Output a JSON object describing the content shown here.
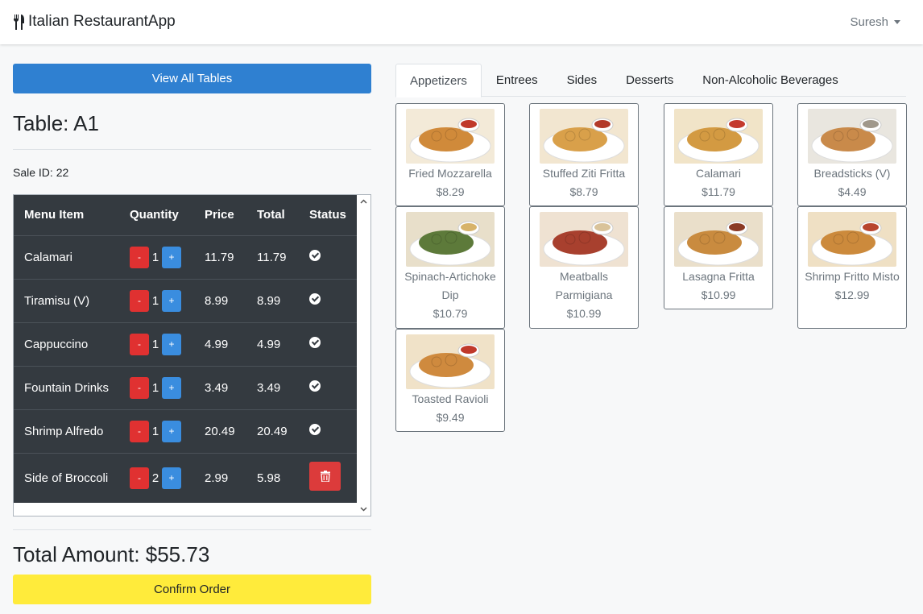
{
  "navbar": {
    "brand": "Italian RestaurantApp",
    "brand_icon": "utensils-icon",
    "user": "Suresh"
  },
  "left": {
    "view_all_tables": "View All Tables",
    "table_title": "Table: A1",
    "sale_id": "Sale ID: 22",
    "headers": [
      "Menu Item",
      "Quantity",
      "Price",
      "Total",
      "Status"
    ],
    "minus_label": "-",
    "plus_label": "+",
    "rows": [
      {
        "item": "Calamari",
        "qty": "1",
        "price": "11.79",
        "total": "11.79",
        "status": "check"
      },
      {
        "item": "Tiramisu (V)",
        "qty": "1",
        "price": "8.99",
        "total": "8.99",
        "status": "check"
      },
      {
        "item": "Cappuccino",
        "qty": "1",
        "price": "4.99",
        "total": "4.99",
        "status": "check"
      },
      {
        "item": "Fountain Drinks",
        "qty": "1",
        "price": "3.49",
        "total": "3.49",
        "status": "check"
      },
      {
        "item": "Shrimp Alfredo",
        "qty": "1",
        "price": "20.49",
        "total": "20.49",
        "status": "check"
      },
      {
        "item": "Side of Broccoli",
        "qty": "2",
        "price": "2.99",
        "total": "5.98",
        "status": "delete"
      }
    ],
    "total_amount": "Total Amount: $55.73",
    "confirm": "Confirm Order"
  },
  "tabs": [
    "Appetizers",
    "Entrees",
    "Sides",
    "Desserts",
    "Non-Alcoholic Beverages"
  ],
  "active_tab": "Appetizers",
  "menu": [
    {
      "name": "Fried Mozzarella",
      "price": "$8.29"
    },
    {
      "name": "Stuffed Ziti Fritta",
      "price": "$8.79"
    },
    {
      "name": "Calamari",
      "price": "$11.79"
    },
    {
      "name": "Breadsticks (V)",
      "price": "$4.49"
    },
    {
      "name": "Spinach-Artichoke Dip",
      "price": "$10.79"
    },
    {
      "name": "Meatballs Parmigiana",
      "price": "$10.99"
    },
    {
      "name": "Lasagna Fritta",
      "price": "$10.99"
    },
    {
      "name": "Shrimp Fritto Misto",
      "price": "$12.99"
    },
    {
      "name": "Toasted Ravioli",
      "price": "$9.49"
    }
  ],
  "colors": {
    "primary": "#2f80d1",
    "danger": "#dc3b3b",
    "warning": "#ffeb3b",
    "dark": "#343a40"
  }
}
